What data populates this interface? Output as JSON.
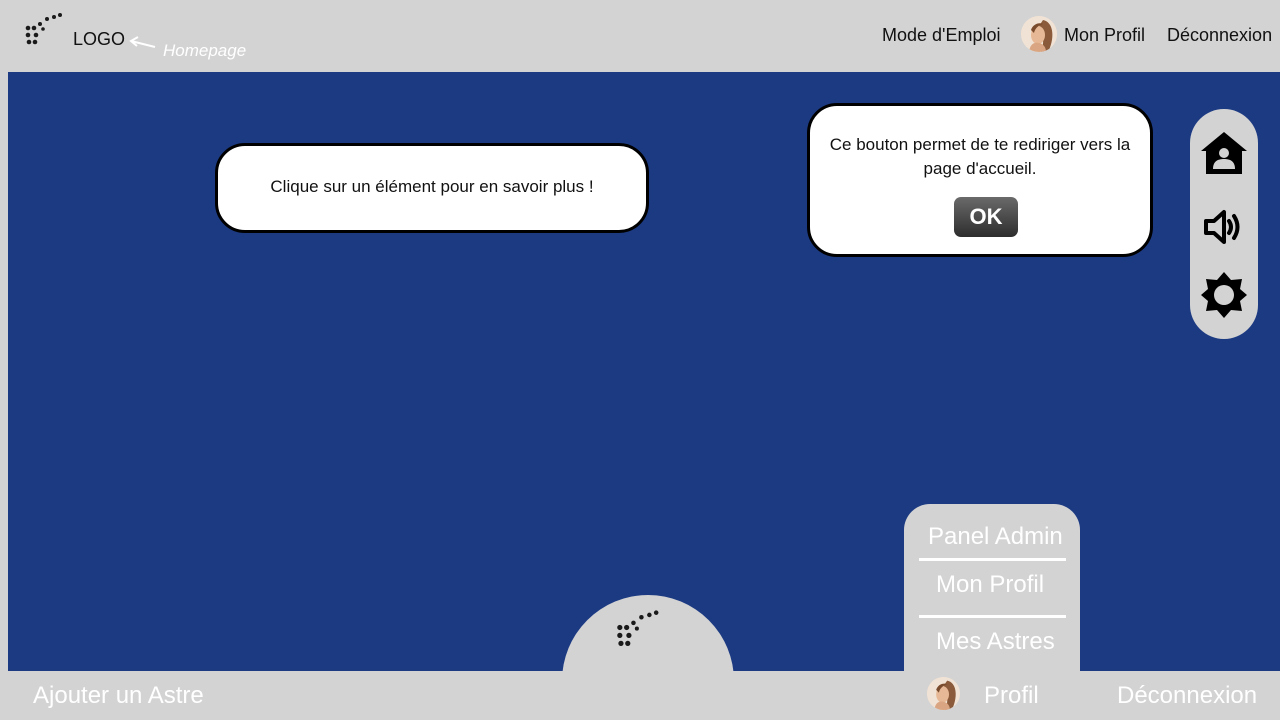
{
  "header": {
    "logo_label": "LOGO",
    "annotation": "Homepage",
    "links": {
      "guide": "Mode d'Emploi",
      "profile": "Mon Profil",
      "logout": "Déconnexion"
    }
  },
  "main": {
    "hint_bubble": "Clique sur un élément pour en savoir plus !",
    "info_bubble": {
      "text": "Ce bouton permet de te rediriger vers la page d'accueil.",
      "ok_label": "OK"
    },
    "side_buttons": [
      "home-icon",
      "speaker-icon",
      "settings-icon"
    ]
  },
  "user_menu": {
    "items": [
      "Panel Admin",
      "Mon Profil",
      "Mes Astres"
    ]
  },
  "footer": {
    "add_label": "Ajouter un Astre",
    "profile_label": "Profil",
    "logout_label": "Déconnexion"
  },
  "colors": {
    "background": "#1c3a82",
    "bars": "#d3d3d3",
    "bubble": "#ffffff"
  }
}
